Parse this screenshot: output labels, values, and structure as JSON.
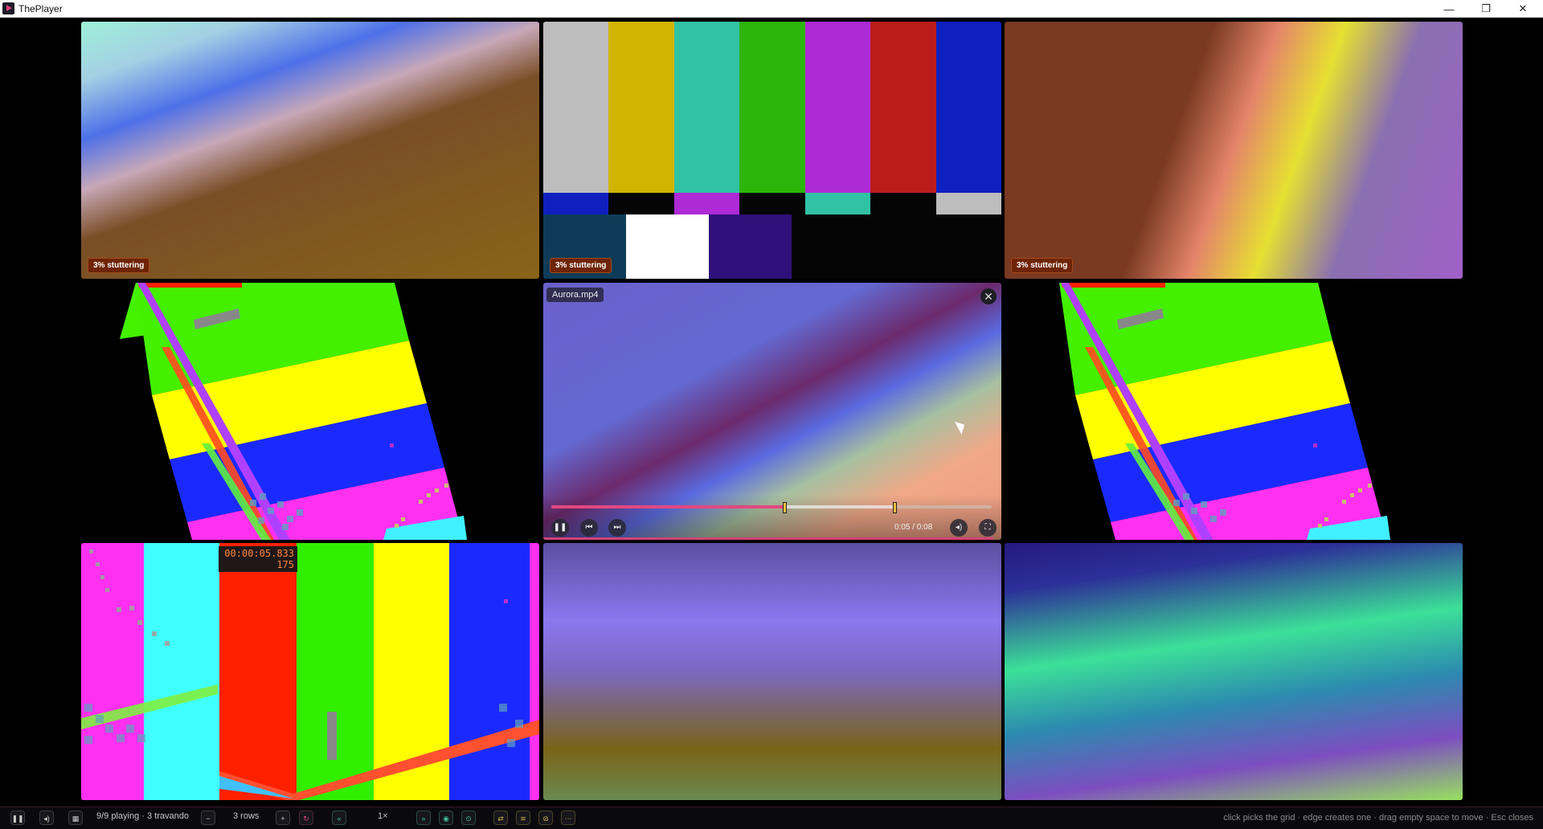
{
  "window": {
    "title": "ThePlayer",
    "minimize": "—",
    "maximize": "❐",
    "close": "✕"
  },
  "tiles": {
    "badge": "3% stuttering",
    "player": {
      "filename": "Aurora.mp4",
      "close": "✕",
      "time": "0:05 / 0:08",
      "progress": 0.53,
      "loop_in": 0.53,
      "loop_out": 0.78,
      "play_pause": "❚❚",
      "prev": "⏮",
      "next": "⏭",
      "mute": "◂)",
      "fullscreen": "⛶"
    },
    "timecode_line1": "00:00:05.833",
    "timecode_line2": "175"
  },
  "colorbars": {
    "top": [
      "#bdbdbd",
      "#d0b400",
      "#31c2a5",
      "#2cb50a",
      "#ad2ad6",
      "#bd1c1c",
      "#1020c0"
    ],
    "mid": [
      "#1020c0",
      "#050505",
      "#ad2ad6",
      "#050505",
      "#31c2a5",
      "#050505",
      "#bdbdbd"
    ],
    "bot": [
      "#0e3c58",
      "#ffffff",
      "#30107a"
    ]
  },
  "bottombar": {
    "pause": "❚❚",
    "mute": "◂)",
    "layout": "▦",
    "status": "9/9 playing · 3 travando",
    "minus": "−",
    "rows": "3 rows",
    "plus": "+",
    "reset": "↻",
    "rewind": "«",
    "speed": "1×",
    "forward": "»",
    "eye": "◉",
    "snap": "⊙",
    "shuffle": "⇄",
    "layers": "≋",
    "link": "⊘",
    "more": "⋯",
    "hint": "click picks the grid · edge creates one · drag empty space to move · Esc closes"
  }
}
